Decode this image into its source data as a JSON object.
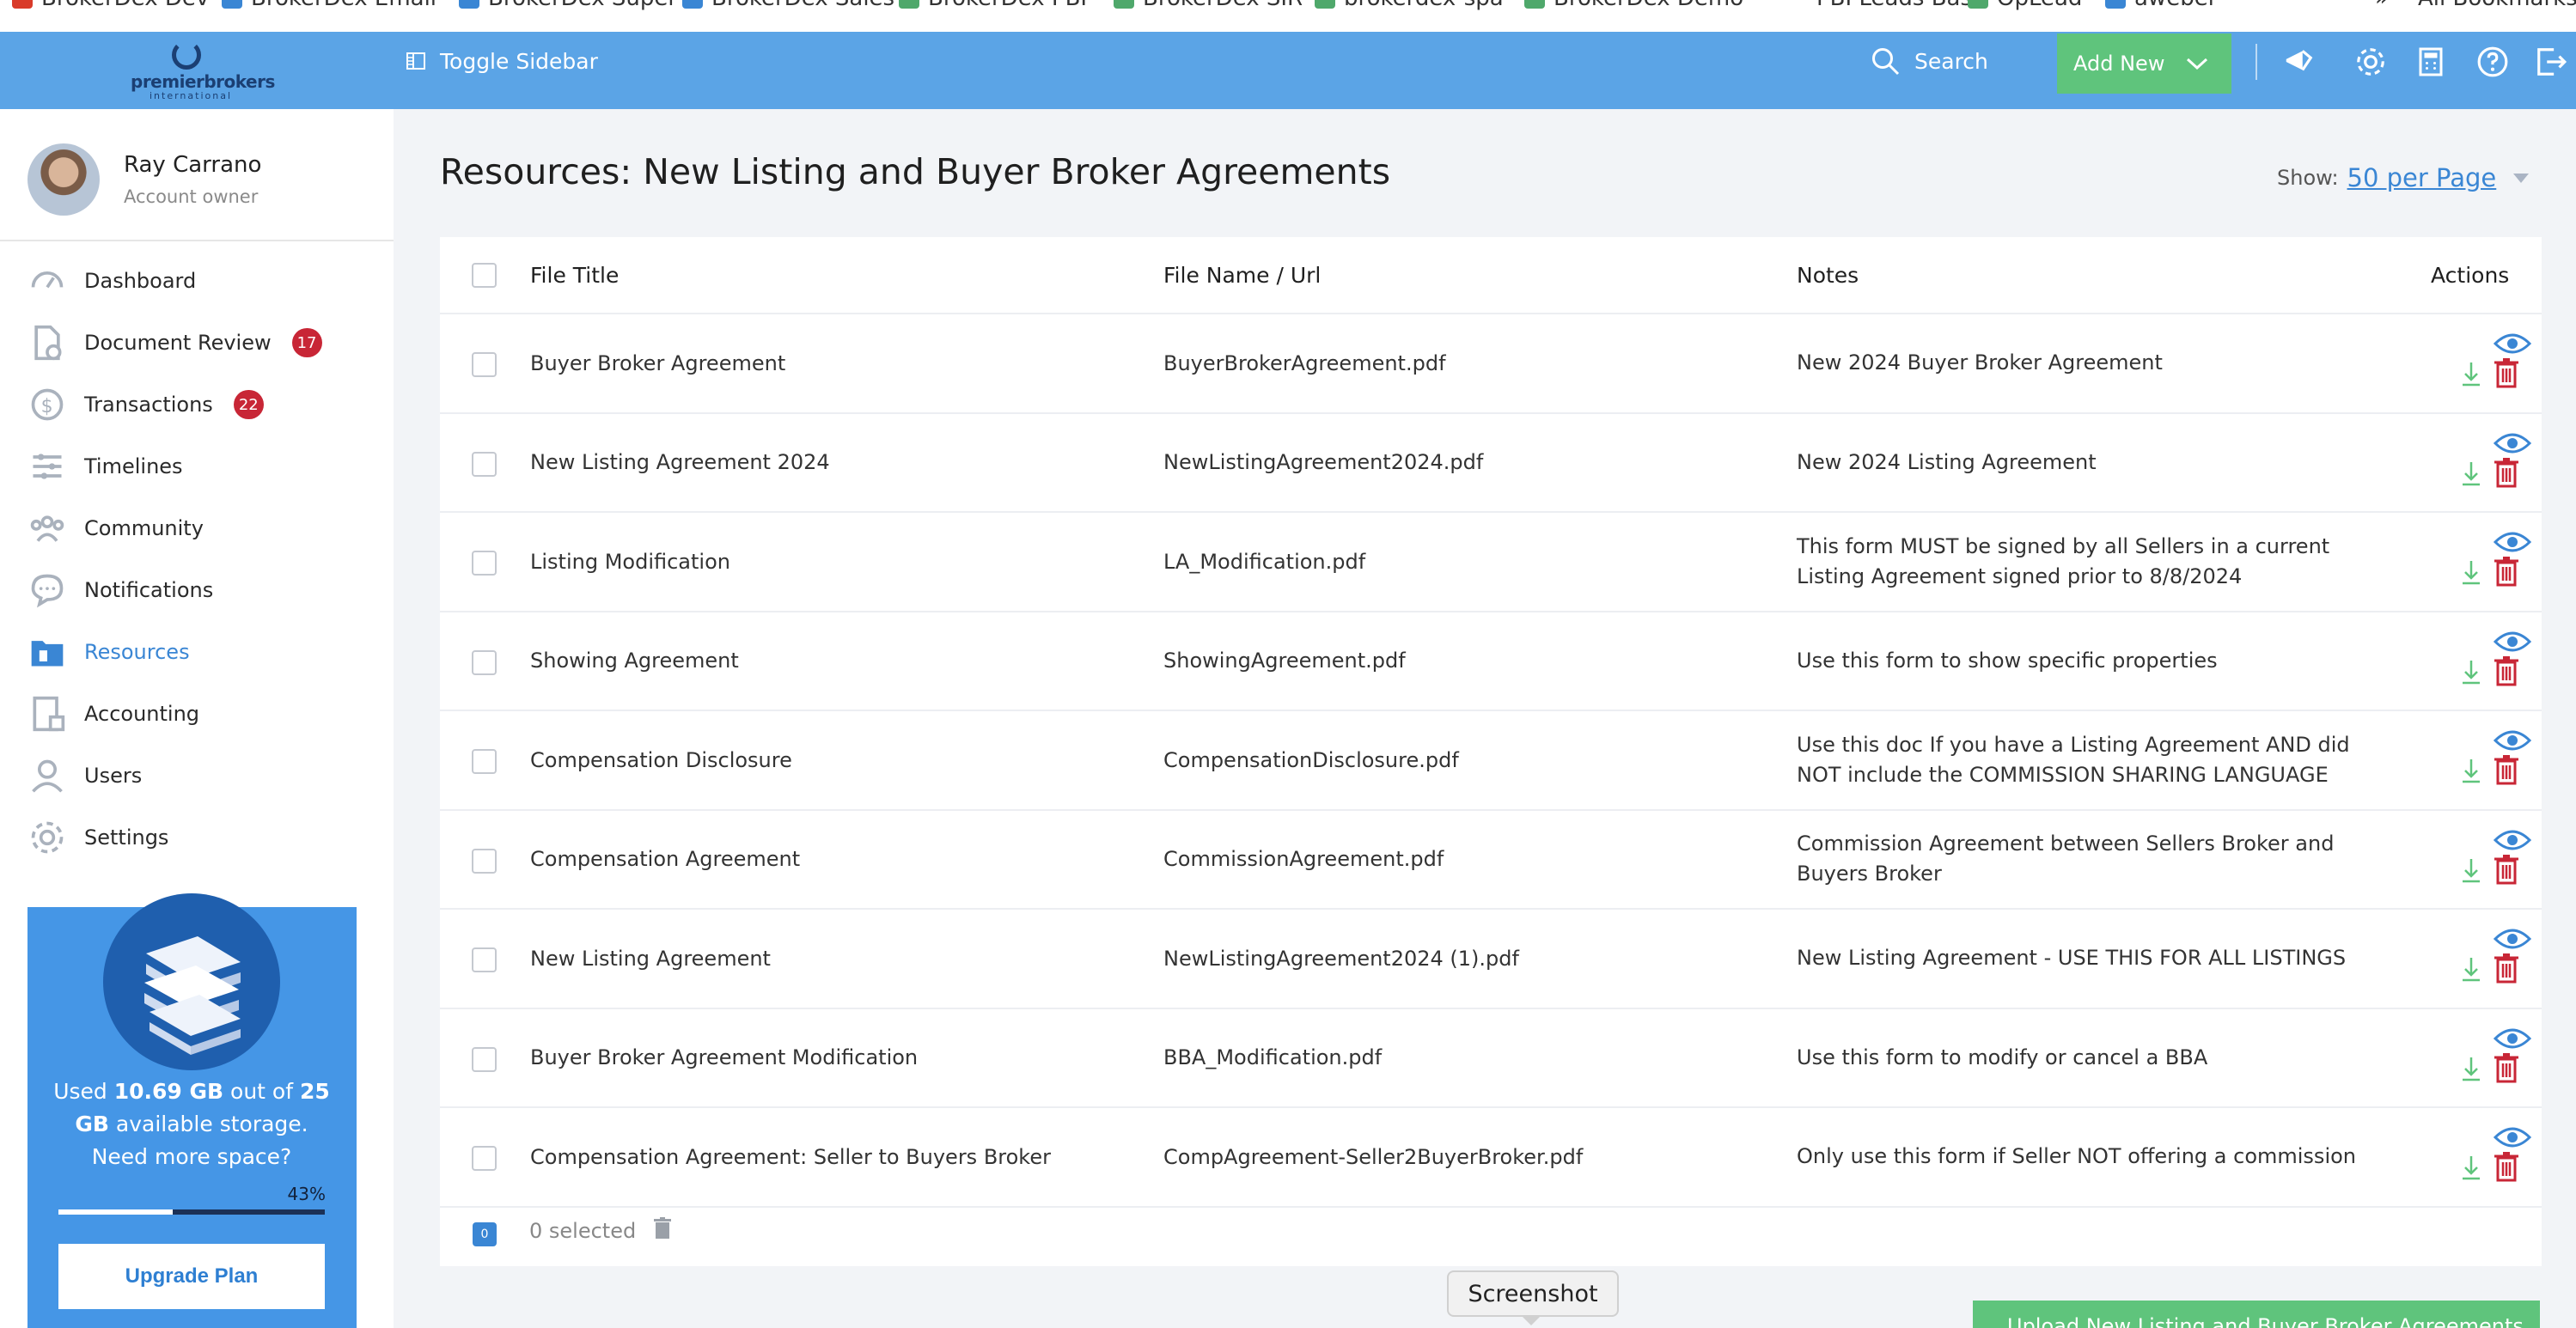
{
  "bookmarks": [
    {
      "label": "BrokerDex Dev",
      "color": "#d93b2a"
    },
    {
      "label": "BrokerDex Email",
      "color": "#3a86d4"
    },
    {
      "label": "BrokerDex Super",
      "color": "#3a86d4"
    },
    {
      "label": "BrokerDex Sales",
      "color": "#3a86d4"
    },
    {
      "label": "BrokerDex PBI",
      "color": "#4fa86b"
    },
    {
      "label": "BrokerDex SIR",
      "color": "#4fa86b"
    },
    {
      "label": "brokerdex-spa",
      "color": "#4fa86b"
    },
    {
      "label": "BrokerDex Demo",
      "color": "#4fa86b"
    },
    {
      "label": "PBI Leads Bash",
      "color": "#ffffff"
    },
    {
      "label": "OpLead",
      "color": "#4fa86b"
    },
    {
      "label": "aweber",
      "color": "#3a86d4"
    },
    {
      "label": "»",
      "color": "#ffffff"
    },
    {
      "label": "All Bookmarks",
      "color": "#ffffff"
    }
  ],
  "header": {
    "logo_main": "premierbrokers",
    "logo_sub": "international",
    "toggle_sidebar": "Toggle Sidebar",
    "search": "Search",
    "add_new": "Add New"
  },
  "sidebar": {
    "user_name": "Ray Carrano",
    "user_role": "Account owner",
    "items": [
      {
        "label": "Dashboard",
        "badge": null,
        "icon": "dashboard-icon"
      },
      {
        "label": "Document Review",
        "badge": "17",
        "icon": "document-review-icon"
      },
      {
        "label": "Transactions",
        "badge": "22",
        "icon": "transactions-icon"
      },
      {
        "label": "Timelines",
        "badge": null,
        "icon": "timelines-icon"
      },
      {
        "label": "Community",
        "badge": null,
        "icon": "community-icon"
      },
      {
        "label": "Notifications",
        "badge": null,
        "icon": "notifications-icon"
      },
      {
        "label": "Resources",
        "badge": null,
        "icon": "resources-icon"
      },
      {
        "label": "Accounting",
        "badge": null,
        "icon": "accounting-icon"
      },
      {
        "label": "Users",
        "badge": null,
        "icon": "users-icon"
      },
      {
        "label": "Settings",
        "badge": null,
        "icon": "settings-icon"
      }
    ],
    "active": "Resources",
    "storage": {
      "used_prefix": "Used",
      "used": "10.69 GB",
      "middle": "out of",
      "total": "25 GB",
      "suffix": "available storage.",
      "cta": "Need more space?",
      "percent_label": "43%",
      "percent": 43,
      "upgrade_label": "Upgrade Plan"
    }
  },
  "main": {
    "title": "Resources: New Listing and Buyer Broker Agreements",
    "show_label": "Show:",
    "per_page": "50 per Page",
    "columns": [
      "File Title",
      "File Name / Url",
      "Notes",
      "Actions"
    ],
    "rows": [
      {
        "title": "Buyer Broker Agreement",
        "file": "BuyerBrokerAgreement.pdf",
        "notes": "New 2024 Buyer Broker Agreement"
      },
      {
        "title": "New Listing Agreement 2024",
        "file": "NewListingAgreement2024.pdf",
        "notes": "New 2024 Listing Agreement"
      },
      {
        "title": "Listing Modification",
        "file": "LA_Modification.pdf",
        "notes": "This form MUST be signed by all Sellers in a current Listing Agreement signed prior to 8/8/2024"
      },
      {
        "title": "Showing Agreement",
        "file": "ShowingAgreement.pdf",
        "notes": "Use this form to show specific properties"
      },
      {
        "title": "Compensation Disclosure",
        "file": "CompensationDisclosure.pdf",
        "notes": "Use this doc If you have a Listing Agreement AND did NOT include the COMMISSION SHARING LANGUAGE"
      },
      {
        "title": "Compensation Agreement",
        "file": "CommissionAgreement.pdf",
        "notes": "Commission Agreement between Sellers Broker and Buyers Broker"
      },
      {
        "title": "New Listing Agreement",
        "file": "NewListingAgreement2024 (1).pdf",
        "notes": "New Listing Agreement - USE THIS FOR ALL LISTINGS"
      },
      {
        "title": "Buyer Broker Agreement Modification",
        "file": "BBA_Modification.pdf",
        "notes": "Use this form to modify or cancel a BBA"
      },
      {
        "title": "Compensation Agreement: Seller to Buyers Broker",
        "file": "CompAgreement-Seller2BuyerBroker.pdf",
        "notes": "Only use this form if Seller NOT offering a commission"
      }
    ],
    "selected_count": "0",
    "selected_label": "0 selected"
  },
  "tooltip": "Screenshot",
  "upload_button": "Upload New Listing and Buyer Broker Agreements",
  "colors": {
    "brand_blue": "#5ba4e6",
    "accent_green": "#5fc47c",
    "link_blue": "#3a86d4",
    "delete_red": "#c82636"
  }
}
